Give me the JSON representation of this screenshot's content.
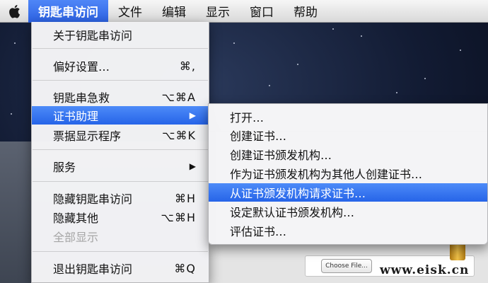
{
  "menubar": {
    "items": [
      {
        "label": "钥匙串访问"
      },
      {
        "label": "文件"
      },
      {
        "label": "编辑"
      },
      {
        "label": "显示"
      },
      {
        "label": "窗口"
      },
      {
        "label": "帮助"
      }
    ]
  },
  "app_menu": {
    "items": [
      {
        "label": "关于钥匙串访问",
        "shortcut": ""
      },
      {
        "label": "偏好设置…",
        "shortcut": "⌘,"
      },
      {
        "label": "钥匙串急救",
        "shortcut": "⌥⌘A"
      },
      {
        "label": "证书助理",
        "shortcut": "▶"
      },
      {
        "label": "票据显示程序",
        "shortcut": "⌥⌘K"
      },
      {
        "label": "服务",
        "shortcut": "▶"
      },
      {
        "label": "隐藏钥匙串访问",
        "shortcut": "⌘H"
      },
      {
        "label": "隐藏其他",
        "shortcut": "⌥⌘H"
      },
      {
        "label": "全部显示",
        "shortcut": ""
      },
      {
        "label": "退出钥匙串访问",
        "shortcut": "⌘Q"
      }
    ]
  },
  "cert_submenu": {
    "items": [
      {
        "label": "打开…"
      },
      {
        "label": "创建证书…"
      },
      {
        "label": "创建证书颁发机构…"
      },
      {
        "label": "作为证书颁发机构为其他人创建证书…"
      },
      {
        "label": "从证书颁发机构请求证书…"
      },
      {
        "label": "设定默认证书颁发机构…"
      },
      {
        "label": "评估证书…"
      }
    ]
  },
  "background_window": {
    "choose_file_label": "Choose File..."
  },
  "watermark": "www.eisk.cn",
  "colors": {
    "highlight": "#2c6be8",
    "menu_bg": "#f4f4f6",
    "disabled_text": "#a6a6a6"
  }
}
